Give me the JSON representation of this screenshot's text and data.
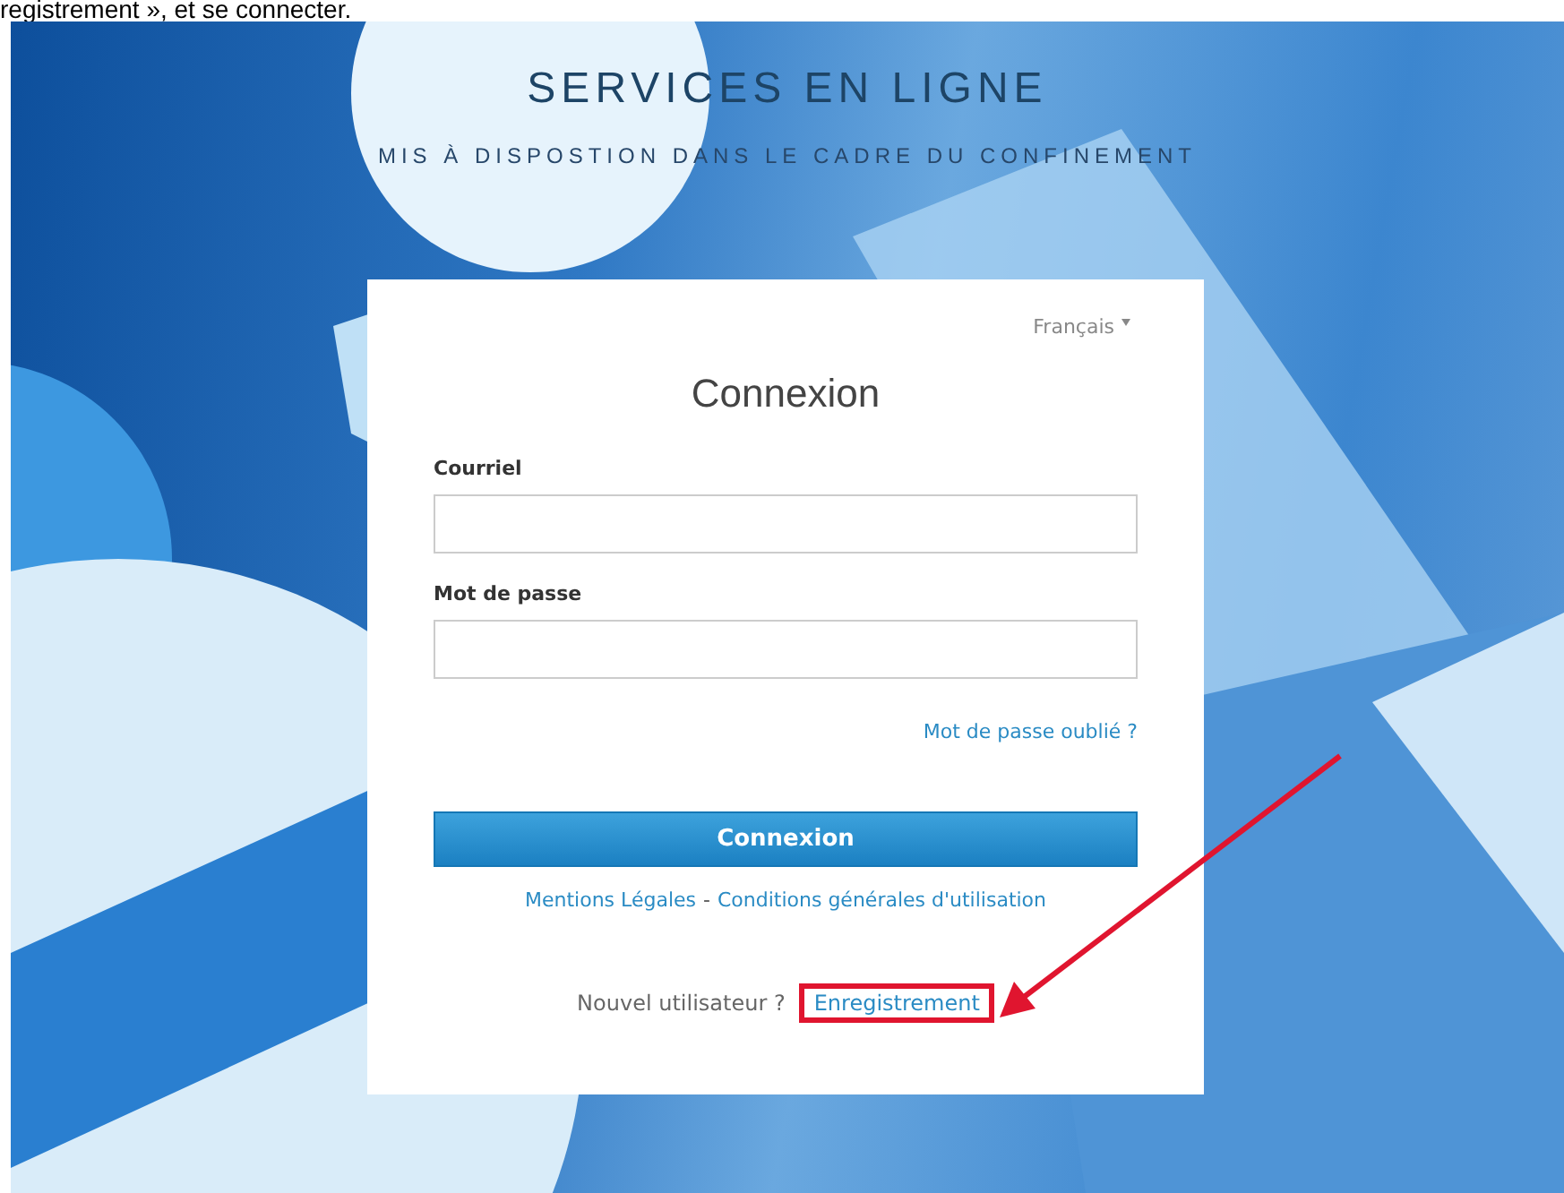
{
  "caption_fragment": "registrement », et se connecter.",
  "header": {
    "title": "SERVICES EN LIGNE",
    "subtitle": "MIS À DISPOSTION DANS LE CADRE DU CONFINEMENT"
  },
  "login": {
    "language": "Français",
    "heading": "Connexion",
    "fields": [
      {
        "label": "Courriel"
      },
      {
        "label": "Mot de passe"
      }
    ],
    "forgot_link": "Mot de passe oublié ?",
    "submit": "Connexion",
    "footer_links": [
      "Mentions Légales",
      "Conditions générales d'utilisation"
    ],
    "footer_separator": "-",
    "register_prompt": "Nouvel utilisateur ?",
    "register_link": "Enregistrement",
    "register_highlighted": true
  }
}
